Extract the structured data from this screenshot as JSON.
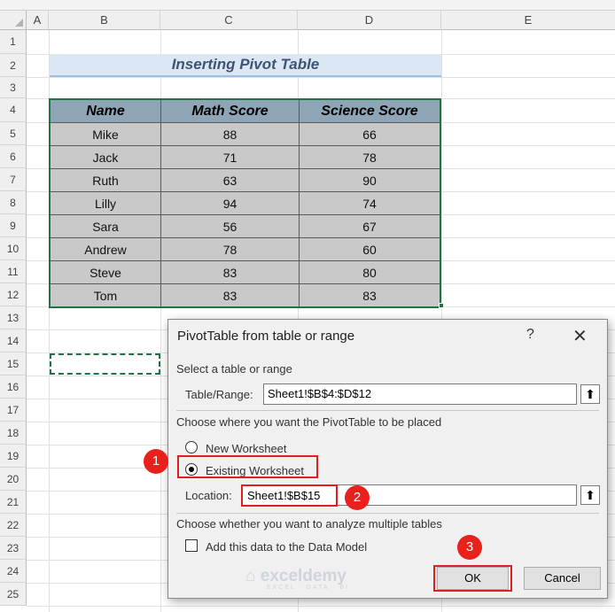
{
  "columns": [
    "A",
    "B",
    "C",
    "D",
    "E"
  ],
  "rows": [
    "1",
    "2",
    "3",
    "4",
    "5",
    "6",
    "7",
    "8",
    "9",
    "10",
    "11",
    "12",
    "13",
    "14",
    "15",
    "16",
    "17",
    "18",
    "19",
    "20",
    "21",
    "22",
    "23",
    "24",
    "25"
  ],
  "sheet_title": "Inserting Pivot Table",
  "table": {
    "headers": [
      "Name",
      "Math Score",
      "Science Score"
    ],
    "rows": [
      [
        "Mike",
        "88",
        "66"
      ],
      [
        "Jack",
        "71",
        "78"
      ],
      [
        "Ruth",
        "63",
        "90"
      ],
      [
        "Lilly",
        "94",
        "74"
      ],
      [
        "Sara",
        "56",
        "67"
      ],
      [
        "Andrew",
        "78",
        "60"
      ],
      [
        "Steve",
        "83",
        "80"
      ],
      [
        "Tom",
        "83",
        "83"
      ]
    ]
  },
  "dialog": {
    "title": "PivotTable from table or range",
    "help": "?",
    "close": "✕",
    "section1": "Select a table or range",
    "table_range_label": "Table/Range:",
    "table_range_value": "Sheet1!$B$4:$D$12",
    "section2": "Choose where you want the PivotTable to be placed",
    "option_new": "New Worksheet",
    "option_existing": "Existing Worksheet",
    "selected_option": "Existing Worksheet",
    "location_label": "Location:",
    "location_value": "Sheet1!$B$15",
    "section3": "Choose whether you want to analyze multiple tables",
    "data_model_label": "Add this data to the Data Model",
    "ok": "OK",
    "cancel": "Cancel"
  },
  "markers": [
    "1",
    "2",
    "3"
  ],
  "watermark": {
    "name": "exceldemy",
    "tagline": "EXCEL · DATA · BI"
  },
  "colors": {
    "accent_green": "#217346",
    "marker_red": "#e8211d",
    "header_fill": "#8ea4b7",
    "cell_fill": "#c9c9c9",
    "title_fill": "#dbe7f4"
  },
  "icons": {
    "up_arrow": "collapse-dialog-icon"
  }
}
